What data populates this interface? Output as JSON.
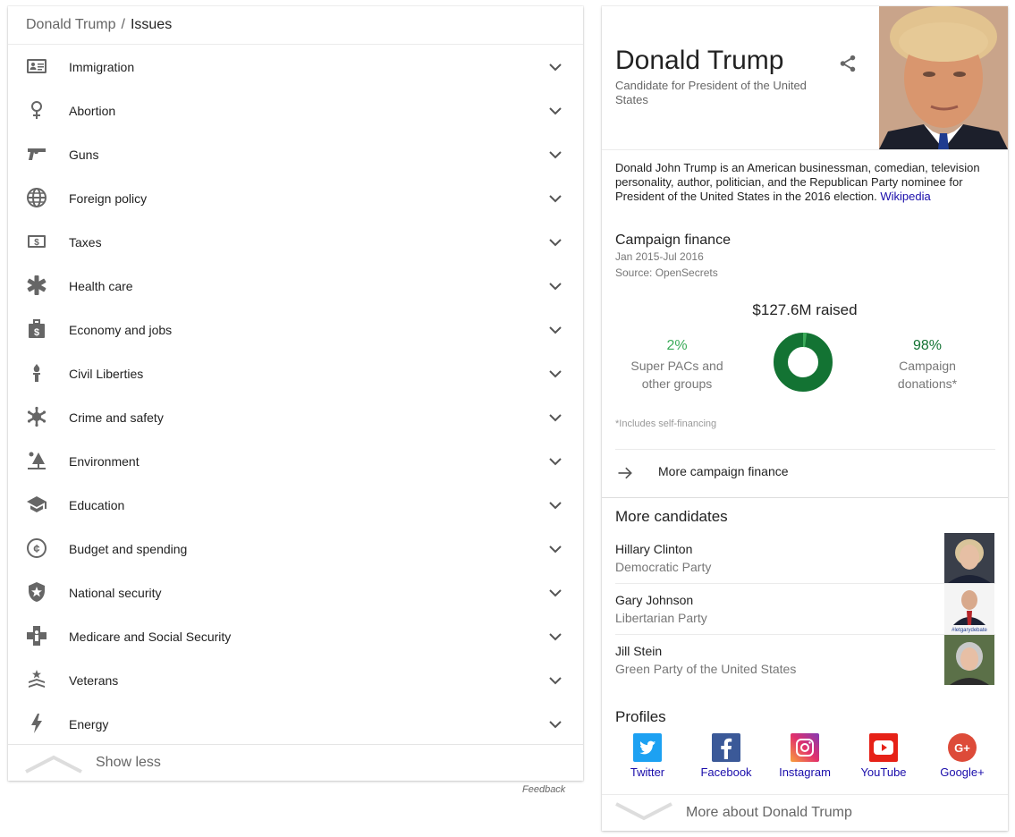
{
  "breadcrumb": {
    "parent": "Donald Trump",
    "separator": "/",
    "current": "Issues"
  },
  "issues": [
    {
      "label": "Immigration",
      "icon": "id-card-icon"
    },
    {
      "label": "Abortion",
      "icon": "female-symbol-icon"
    },
    {
      "label": "Guns",
      "icon": "gun-icon"
    },
    {
      "label": "Foreign policy",
      "icon": "globe-icon"
    },
    {
      "label": "Taxes",
      "icon": "money-bill-icon"
    },
    {
      "label": "Health care",
      "icon": "medical-asterisk-icon"
    },
    {
      "label": "Economy and jobs",
      "icon": "briefcase-dollar-icon"
    },
    {
      "label": "Civil Liberties",
      "icon": "torch-icon"
    },
    {
      "label": "Crime and safety",
      "icon": "sheriff-star-icon"
    },
    {
      "label": "Environment",
      "icon": "tree-sun-icon"
    },
    {
      "label": "Education",
      "icon": "graduation-cap-icon"
    },
    {
      "label": "Budget and spending",
      "icon": "cent-coin-icon"
    },
    {
      "label": "National security",
      "icon": "shield-star-icon"
    },
    {
      "label": "Medicare and Social Security",
      "icon": "medical-cross-person-icon"
    },
    {
      "label": "Veterans",
      "icon": "chevron-star-icon"
    },
    {
      "label": "Energy",
      "icon": "lightning-icon"
    }
  ],
  "show_less": "Show less",
  "feedback": "Feedback",
  "panel": {
    "name": "Donald Trump",
    "subtitle": "Candidate for President of the United States",
    "description": "Donald John Trump is an American businessman, comedian, television personality, author, politician, and the Republican Party nominee for President of the United States in the 2016 election.",
    "wiki_link": "Wikipedia",
    "campaign_finance": {
      "title": "Campaign finance",
      "period": "Jan 2015-Jul 2016",
      "source": "Source: OpenSecrets",
      "raised": "$127.6M raised",
      "left_pct": "2%",
      "left_label_1": "Super PACs and",
      "left_label_2": "other groups",
      "right_pct": "98%",
      "right_label_1": "Campaign",
      "right_label_2": "donations*",
      "left_fraction": 0.02,
      "note": "*Includes self-financing",
      "more": "More campaign finance",
      "colors": {
        "left": "#3cab5a",
        "right": "#137333"
      }
    },
    "more_candidates": {
      "title": "More candidates",
      "items": [
        {
          "name": "Hillary Clinton",
          "party": "Democratic Party"
        },
        {
          "name": "Gary Johnson",
          "party": "Libertarian Party",
          "photo_caption": "#letgarydebate"
        },
        {
          "name": "Jill Stein",
          "party": "Green Party of the United States"
        }
      ]
    },
    "profiles": {
      "title": "Profiles",
      "items": [
        {
          "label": "Twitter",
          "icon": "twitter-icon",
          "color": "#1da1f2"
        },
        {
          "label": "Facebook",
          "icon": "facebook-icon",
          "color": "#3b5998"
        },
        {
          "label": "Instagram",
          "icon": "instagram-icon",
          "color": "#c13584"
        },
        {
          "label": "YouTube",
          "icon": "youtube-icon",
          "color": "#e62117"
        },
        {
          "label": "Google+",
          "icon": "google-plus-icon",
          "color": "#dd4b39"
        }
      ]
    },
    "more_about": "More about Donald Trump"
  }
}
